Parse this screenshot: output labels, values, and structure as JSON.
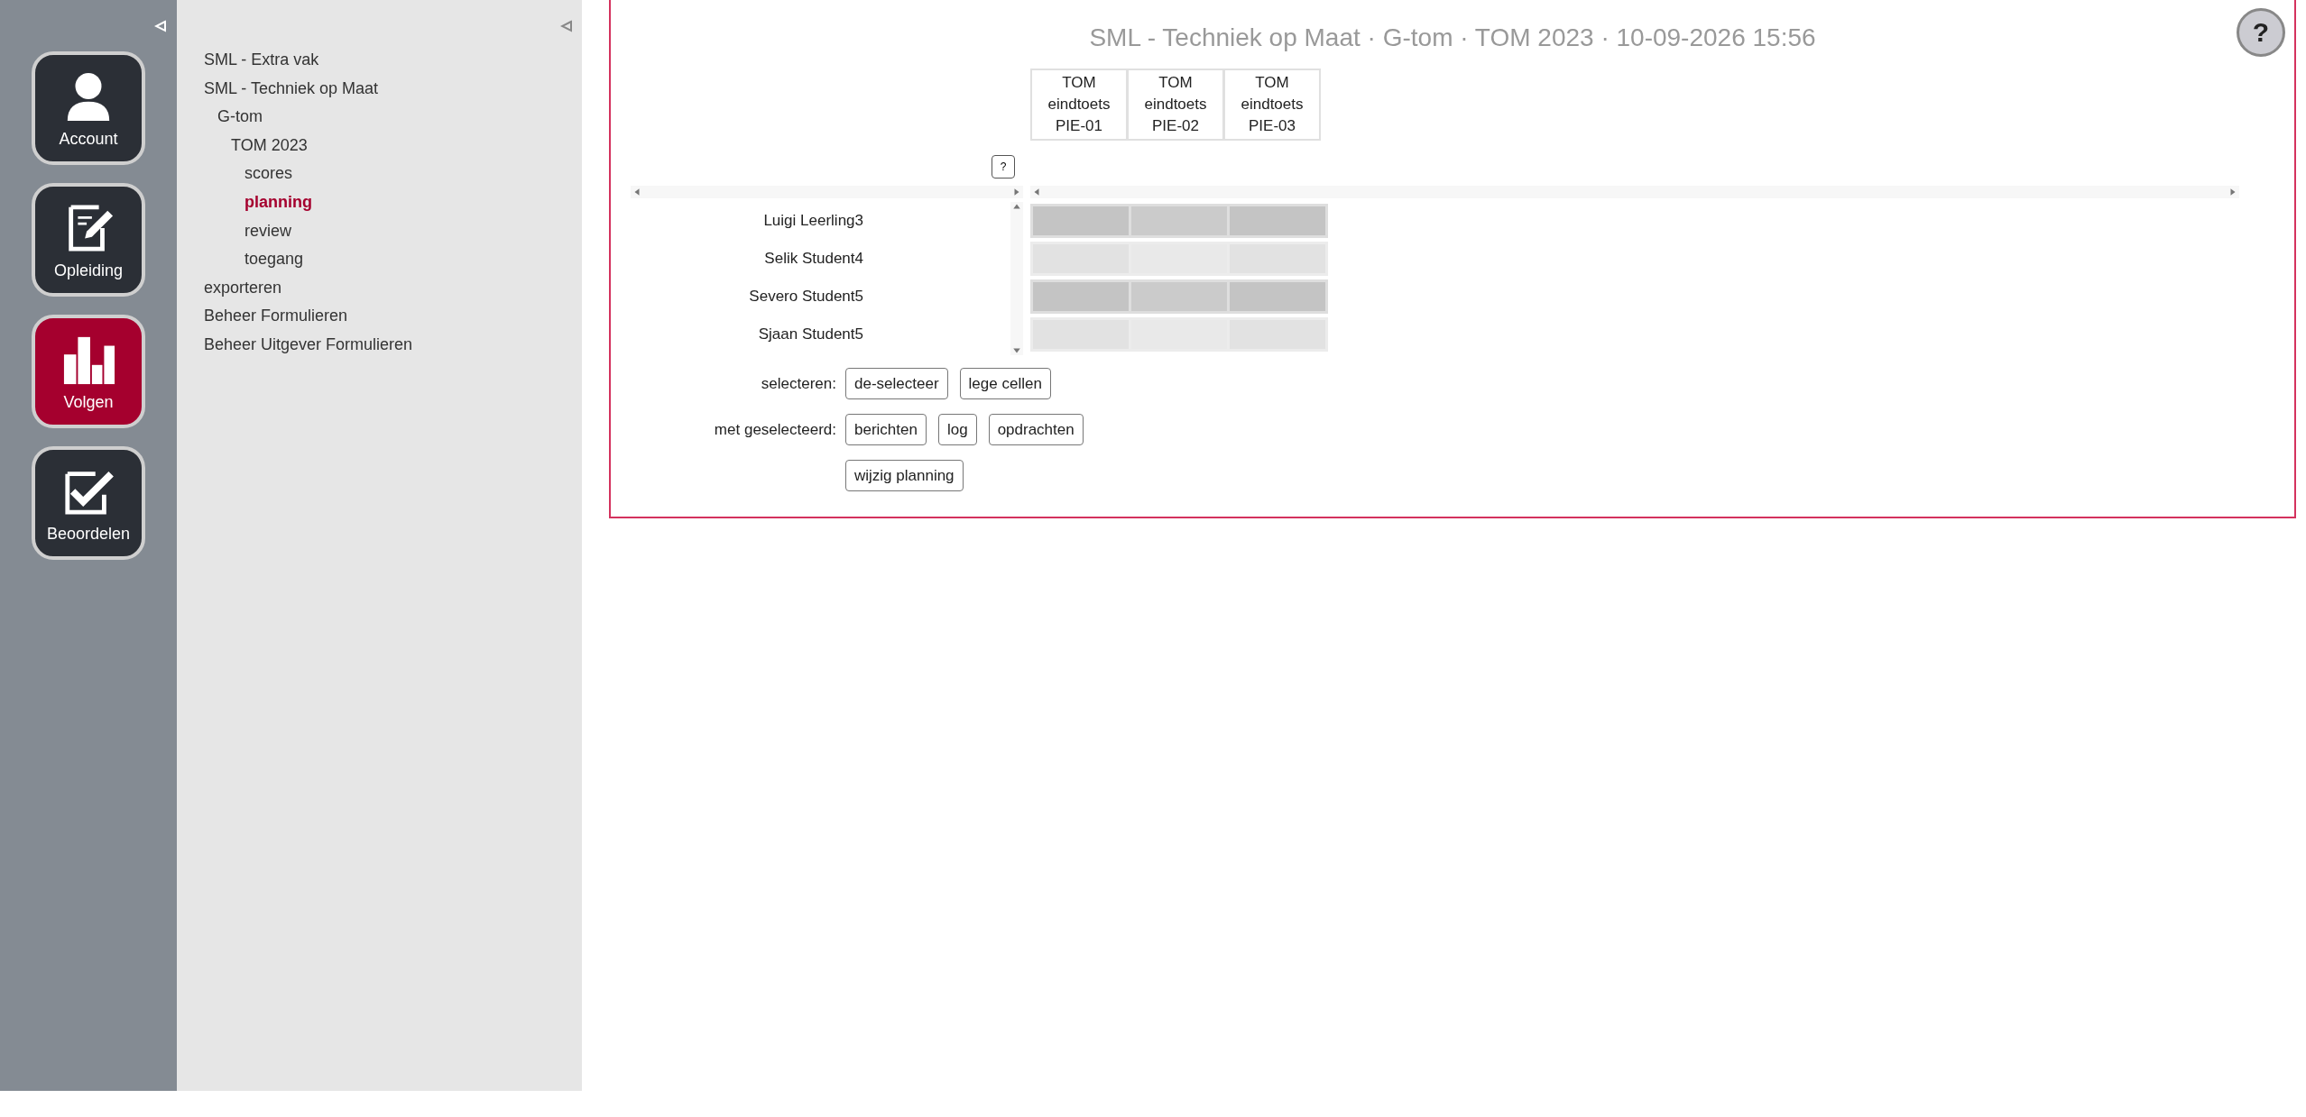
{
  "sidebar": {
    "items": [
      {
        "label": "Account",
        "selected": false
      },
      {
        "label": "Opleiding",
        "selected": false
      },
      {
        "label": "Volgen",
        "selected": true
      },
      {
        "label": "Beoordelen",
        "selected": false
      }
    ]
  },
  "tree": {
    "items": [
      {
        "label": "SML - Extra vak",
        "selected": false
      },
      {
        "label": "SML - Techniek op Maat",
        "selected": false,
        "children": [
          {
            "label": "G-tom",
            "selected": false,
            "children": [
              {
                "label": "TOM 2023",
                "selected": false,
                "children": [
                  {
                    "label": "scores",
                    "selected": false
                  },
                  {
                    "label": "planning",
                    "selected": true
                  },
                  {
                    "label": "review",
                    "selected": false
                  },
                  {
                    "label": "toegang",
                    "selected": false
                  }
                ]
              }
            ]
          }
        ]
      },
      {
        "label": "exporteren",
        "selected": false
      },
      {
        "label": "Beheer Formulieren",
        "selected": false
      },
      {
        "label": "Beheer Uitgever Formulieren",
        "selected": false
      }
    ]
  },
  "main": {
    "title": "SML - Techniek op Maat · G-tom · TOM 2023 · 10-09-2026 15:56",
    "help_button": "?",
    "columns": [
      "TOM eindtoets PIE-01",
      "TOM eindtoets PIE-02",
      "TOM eindtoets PIE-03"
    ],
    "legend_button": "?",
    "rows": [
      {
        "name": "Luigi Leerling3",
        "selected": true
      },
      {
        "name": "Selik Student4",
        "selected": false
      },
      {
        "name": "Severo Student5",
        "selected": true
      },
      {
        "name": "Sjaan Student5",
        "selected": false
      }
    ],
    "actions": [
      {
        "label": "selecteren:",
        "buttons": [
          "de-selecteer",
          "lege cellen"
        ]
      },
      {
        "label": "met geselecteerd:",
        "buttons": [
          "berichten",
          "log",
          "opdrachten"
        ]
      },
      {
        "buttons": [
          "wijzig planning"
        ]
      }
    ]
  }
}
